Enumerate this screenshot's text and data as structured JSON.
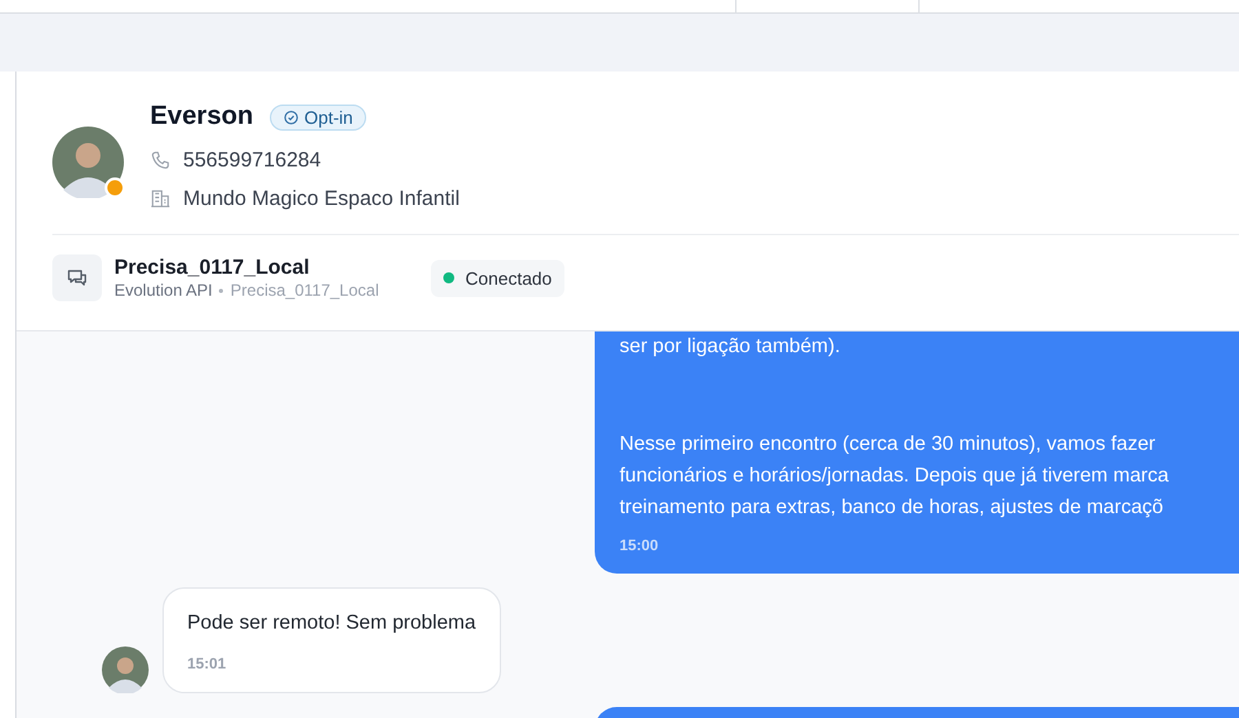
{
  "contact": {
    "name": "Everson",
    "badge": "Opt-in",
    "phone": "556599716284",
    "company": "Mundo Magico Espaco Infantil"
  },
  "channel": {
    "name": "Precisa_0117_Local",
    "provider": "Evolution API",
    "instance": "Precisa_0117_Local",
    "status": "Conectado",
    "connected": true
  },
  "messages": [
    {
      "kind": "outgoing",
      "paragraphs": [
        [
          "ser por ligação também)."
        ],
        [
          "Nesse primeiro encontro (cerca de 30 minutos), vamos fazer",
          "funcionários e horários/jornadas. Depois que já tiverem marca",
          "treinamento para extras, banco de horas, ajustes de marcaçõ"
        ]
      ],
      "time": "15:00"
    },
    {
      "kind": "incoming",
      "paragraphs": [
        [
          "Pode ser remoto! Sem problema"
        ]
      ],
      "time": "15:01"
    },
    {
      "kind": "outgoing"
    }
  ]
}
